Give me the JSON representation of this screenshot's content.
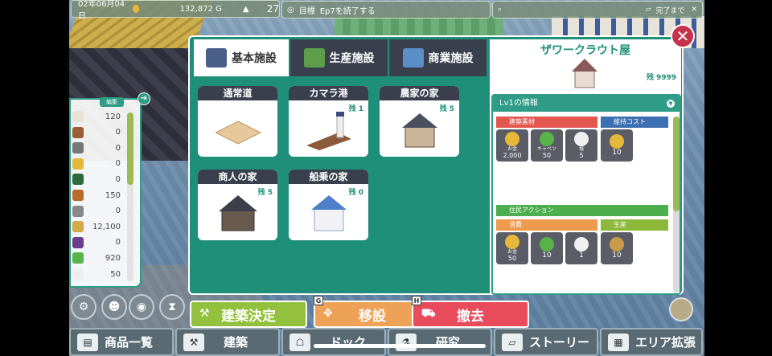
{
  "topbar": {
    "date": "02年06月04日",
    "money": "132,872 G",
    "population": "27"
  },
  "goal": {
    "label": "目標",
    "text": "Ep7を読了する"
  },
  "search": {
    "right_text": "完了まで"
  },
  "inventory": {
    "tag": "編集",
    "items": [
      {
        "icon": "cow-icon",
        "value": "120",
        "color": "#e9e3d5"
      },
      {
        "icon": "horse-icon",
        "value": "0",
        "color": "#9b5d33"
      },
      {
        "icon": "tools-icon",
        "value": "0",
        "color": "#777"
      },
      {
        "icon": "cheese-icon",
        "value": "0",
        "color": "#e5b83a"
      },
      {
        "icon": "leaf-icon",
        "value": "0",
        "color": "#2d6b3c"
      },
      {
        "icon": "wood-icon",
        "value": "150",
        "color": "#b86b2c"
      },
      {
        "icon": "stone-icon",
        "value": "0",
        "color": "#888"
      },
      {
        "icon": "wheat-icon",
        "value": "12,100",
        "color": "#d3a94a"
      },
      {
        "icon": "grape-icon",
        "value": "0",
        "color": "#6b3d8a"
      },
      {
        "icon": "cabbage-icon",
        "value": "920",
        "color": "#58b34a"
      },
      {
        "icon": "cloth-icon",
        "value": "50",
        "color": "#eee"
      }
    ]
  },
  "tabs": [
    {
      "label": "基本施設",
      "icon": "house-icon"
    },
    {
      "label": "生産施設",
      "icon": "field-icon"
    },
    {
      "label": "商業施設",
      "icon": "shop-icon"
    }
  ],
  "cards": [
    {
      "title": "通常道",
      "stock": ""
    },
    {
      "title": "カマラ港",
      "stock": "残 1"
    },
    {
      "title": "農家の家",
      "stock": "残 5"
    },
    {
      "title": "商人の家",
      "stock": "残 5"
    },
    {
      "title": "船乗の家",
      "stock": "残 0"
    }
  ],
  "detail": {
    "name": "ザワークラウト屋",
    "stock": "残 9999",
    "info_title": "Lv1の情報",
    "materials_label": "建築素材",
    "maintenance_label": "維持コスト",
    "materials": [
      {
        "name": "お金",
        "value": "2,000"
      },
      {
        "name": "キャベツ",
        "value": "50"
      },
      {
        "name": "塩",
        "value": "5"
      }
    ],
    "maintenance": [
      {
        "value": "10"
      }
    ],
    "action_label": "住民アクション",
    "consume_label": "消費",
    "produce_label": "生産",
    "consume": [
      {
        "name": "お金",
        "value": "50"
      },
      {
        "value": "10"
      },
      {
        "value": "1"
      }
    ],
    "produce": [
      {
        "value": "10"
      }
    ]
  },
  "actions": [
    {
      "label": "建築決定",
      "hotkey": "",
      "color": "#93c13d"
    },
    {
      "label": "移設",
      "hotkey": "G",
      "color": "#eea257"
    },
    {
      "label": "撤去",
      "hotkey": "H",
      "color": "#e84b5c"
    }
  ],
  "nav": [
    {
      "label": "商品一覧",
      "icon": "box-icon"
    },
    {
      "label": "建築",
      "icon": "hammer-icon"
    },
    {
      "label": "ドック",
      "icon": "robot-icon"
    },
    {
      "label": "研究",
      "icon": "flask-icon"
    },
    {
      "label": "ストーリー",
      "icon": "book-icon"
    },
    {
      "label": "エリア拡張",
      "icon": "map-icon"
    }
  ]
}
